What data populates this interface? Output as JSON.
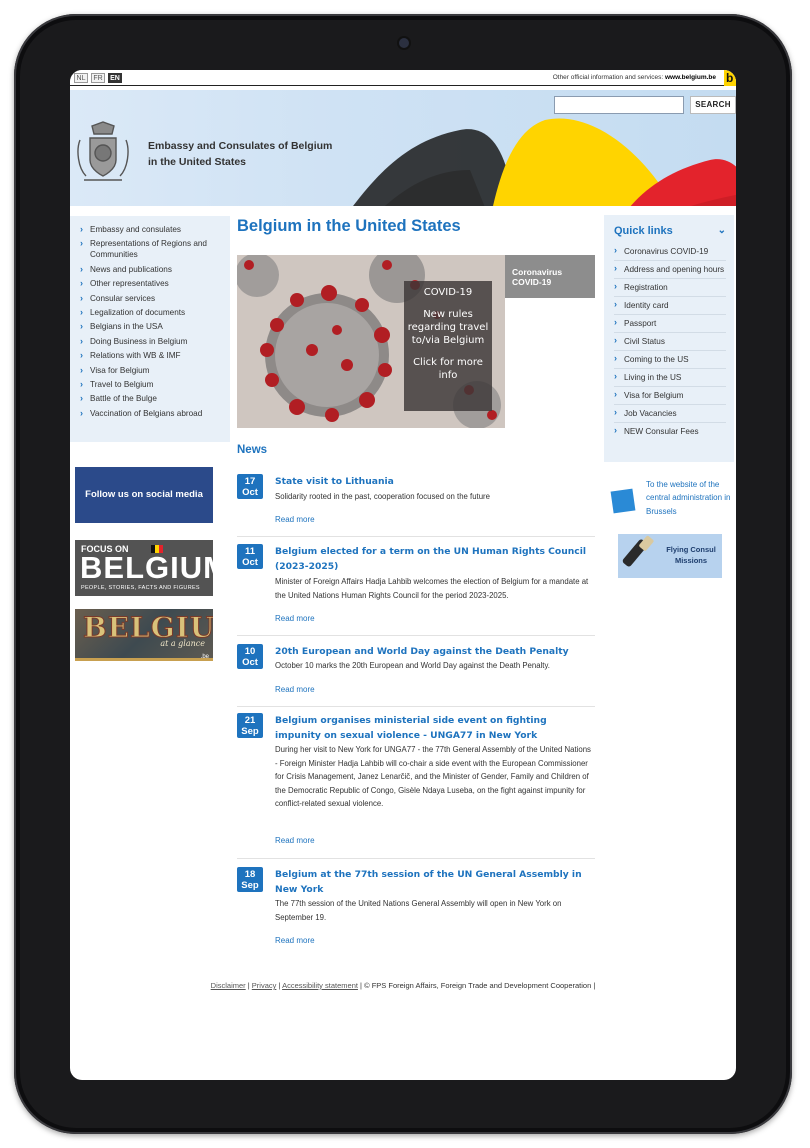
{
  "languages": [
    "NL",
    "FR",
    "EN"
  ],
  "active_language": "EN",
  "topbar": {
    "text": "Other official information and services:",
    "link": "www.belgium.be"
  },
  "search": {
    "button": "SEARCH",
    "placeholder": ""
  },
  "site": {
    "title_line1": "Embassy and Consulates of Belgium",
    "title_line2": "in the United States"
  },
  "leftnav": [
    "Embassy and consulates",
    "Representations of Regions and Communities",
    "News and publications",
    "Other representatives",
    "Consular services",
    "Legalization of documents",
    "Belgians in the USA",
    "Doing Business in Belgium",
    "Relations with WB & IMF",
    "Visa for Belgium",
    "Travel to Belgium",
    "Battle of the Bulge",
    "Vaccination of Belgians abroad"
  ],
  "promos": {
    "social": "Follow us on social media",
    "focus_on": "FOCUS ON",
    "focus_belgium": "BELGIUM",
    "focus_sub": "PEOPLE, STORIES, FACTS AND FIGURES",
    "glance_word": "BELGIUM",
    "glance_sub": "at a glance",
    "glance_be": ".be"
  },
  "main": {
    "title": "Belgium in the United States",
    "covid_tab": [
      "Coronavirus",
      "COVID-19"
    ],
    "covid_overlay": [
      "COVID-19",
      "New rules regarding travel to/via Belgium",
      "Click for more info"
    ],
    "news_heading": "News",
    "read_more": "Read more"
  },
  "news": [
    {
      "day": "17",
      "month": "Oct",
      "title": "State visit to Lithuania",
      "body": "Solidarity rooted in the past, cooperation focused on the future"
    },
    {
      "day": "11",
      "month": "Oct",
      "title": "Belgium elected for a term on the UN Human Rights Council (2023-2025)",
      "body": "Minister of Foreign Affairs Hadja Lahbib welcomes the election of Belgium for a mandate at the United Nations Human Rights Council for the period 2023-2025."
    },
    {
      "day": "10",
      "month": "Oct",
      "title": "20th European and World Day against the Death Penalty",
      "body": "October 10 marks the 20th European and World Day against the Death Penalty."
    },
    {
      "day": "21",
      "month": "Sep",
      "title": "Belgium organises ministerial side event on fighting impunity on sexual violence - UNGA77 in New York",
      "body": "During her visit to New York for UNGA77 - the 77th General Assembly of the United Nations - Foreign Minister Hadja Lahbib will co-chair a side event with the European Commissioner for Crisis Management, Janez Lenarčič, and the Minister of Gender, Family and Children of the Democratic Republic of Congo, Gisèle Ndaya Luseba, on the fight against impunity for conflict-related sexual violence."
    },
    {
      "day": "18",
      "month": "Sep",
      "title": "Belgium at the 77th session of the UN General Assembly in New York",
      "body": "The 77th session of the United Nations General Assembly will open in New York on September 19."
    }
  ],
  "quick_links": {
    "heading": "Quick links",
    "items": [
      "Coronavirus COVID-19",
      "Address and opening hours",
      "Registration",
      "Identity card",
      "Passport",
      "Civil Status",
      "Coming to the US",
      "Living in the US",
      "Visa for Belgium",
      "Job Vacancies",
      "NEW Consular Fees"
    ]
  },
  "right_links": {
    "central": "To the website of the central administration in Brussels",
    "flying": "Flying Consul Missions"
  },
  "footer": {
    "disclaimer": "Disclaimer",
    "privacy": "Privacy",
    "accessibility": "Accessibility statement",
    "copyright": "© FPS Foreign Affairs, Foreign Trade and Development Cooperation"
  },
  "colors": {
    "accent": "#1e73be",
    "nav_bg": "#e8f0f8",
    "flag_black": "#111111",
    "flag_yellow": "#ffd400",
    "flag_red": "#e3232c"
  }
}
